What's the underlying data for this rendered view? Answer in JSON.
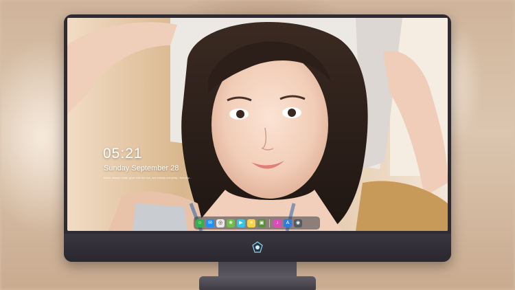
{
  "lock_screen": {
    "time": "05:21",
    "date": "Sunday September  28",
    "quote": "Motto: always smile, grow with the sun, see beauty everyday · Actually..."
  },
  "dock": {
    "items": [
      {
        "name": "finder-icon",
        "color": "#2fb34a",
        "glyph": "☺"
      },
      {
        "name": "messages-icon",
        "color": "#1e90ff",
        "glyph": "✉"
      },
      {
        "name": "safari-icon",
        "color": "#e8e8e8",
        "glyph": "◎"
      },
      {
        "name": "photos-icon",
        "color": "#6cc04a",
        "glyph": "❀"
      },
      {
        "name": "facetime-icon",
        "color": "#2fc6e8",
        "glyph": "▶"
      },
      {
        "name": "notes-icon",
        "color": "#f5d547",
        "glyph": "≡"
      },
      {
        "name": "preview-icon",
        "color": "#5a8f3c",
        "glyph": "▣"
      },
      {
        "name": "music-icon",
        "color": "#e04ab8",
        "glyph": "♪"
      },
      {
        "name": "app-store-icon",
        "color": "#2f7de1",
        "glyph": "A"
      },
      {
        "name": "camera-icon",
        "color": "#555a60",
        "glyph": "◉"
      }
    ]
  },
  "colors": {
    "bezel": "#2e2b33",
    "stand": "#4f4b55",
    "dock_bg": "rgba(60,60,70,0.55)"
  }
}
